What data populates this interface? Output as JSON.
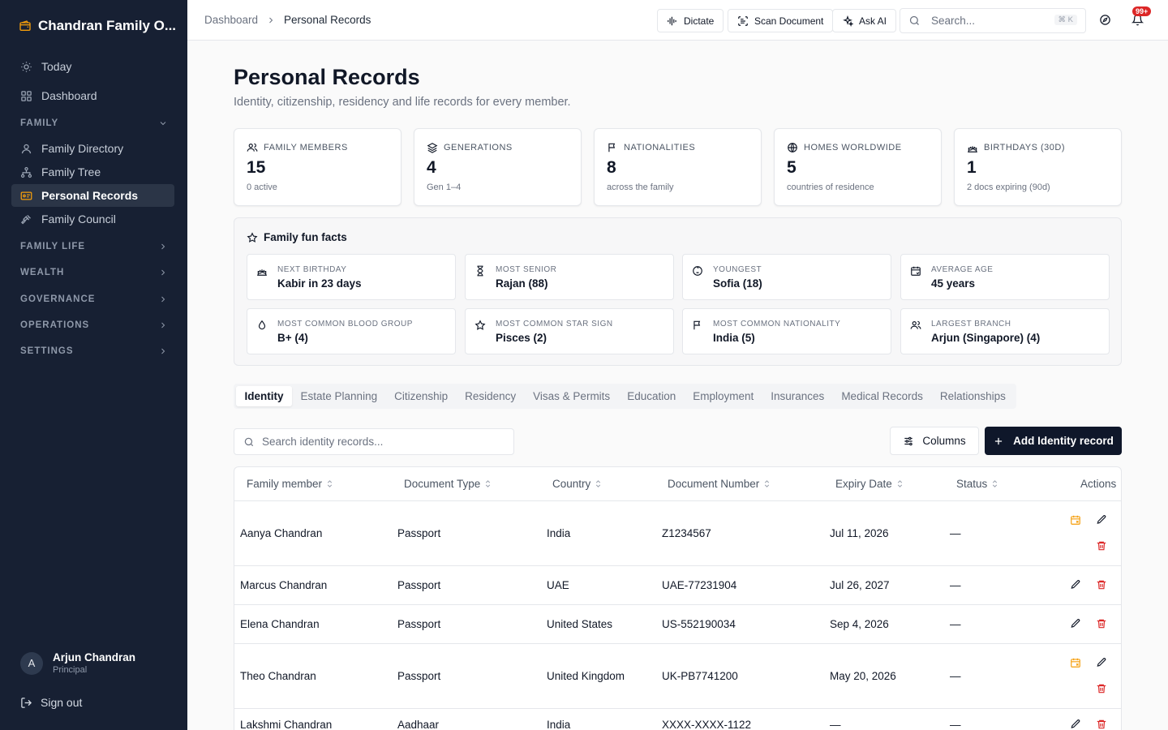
{
  "app": {
    "title": "Chandran Family O..."
  },
  "sidebar": {
    "today": "Today",
    "dashboard": "Dashboard",
    "family_section": "FAMILY",
    "family_items": [
      "Family Directory",
      "Family Tree",
      "Personal Records",
      "Family Council"
    ],
    "sections": [
      "FAMILY LIFE",
      "WEALTH",
      "GOVERNANCE",
      "OPERATIONS",
      "SETTINGS"
    ],
    "user": {
      "initial": "A",
      "name": "Arjun Chandran",
      "role": "Principal"
    },
    "sign_out": "Sign out"
  },
  "topbar": {
    "breadcrumb": [
      "Dashboard",
      "Personal Records"
    ],
    "dictate": "Dictate",
    "scan": "Scan Document",
    "ask_ai": "Ask AI",
    "search_placeholder": "Search...",
    "shortcut": "⌘ K",
    "notifications": "99+"
  },
  "page": {
    "title": "Personal Records",
    "subtitle": "Identity, citizenship, residency and life records for every member."
  },
  "stats": [
    {
      "icon": "users-icon",
      "label": "FAMILY MEMBERS",
      "value": "15",
      "sub": "0 active"
    },
    {
      "icon": "layers-icon",
      "label": "GENERATIONS",
      "value": "4",
      "sub": "Gen 1–4"
    },
    {
      "icon": "flag-icon",
      "label": "NATIONALITIES",
      "value": "8",
      "sub": "across the family"
    },
    {
      "icon": "globe-icon",
      "label": "HOMES WORLDWIDE",
      "value": "5",
      "sub": "countries of residence"
    },
    {
      "icon": "cake-icon",
      "label": "BIRTHDAYS (30D)",
      "value": "1",
      "sub": "2 docs expiring (90d)"
    }
  ],
  "fun_facts": {
    "title": "Family fun facts",
    "items": [
      {
        "icon": "cake-icon",
        "label": "NEXT BIRTHDAY",
        "value": "Kabir in 23 days"
      },
      {
        "icon": "hourglass-icon",
        "label": "MOST SENIOR",
        "value": "Rajan (88)"
      },
      {
        "icon": "baby-icon",
        "label": "YOUNGEST",
        "value": "Sofia (18)"
      },
      {
        "icon": "calendar-icon",
        "label": "AVERAGE AGE",
        "value": "45 years"
      },
      {
        "icon": "droplet-icon",
        "label": "MOST COMMON BLOOD GROUP",
        "value": "B+ (4)"
      },
      {
        "icon": "star-icon",
        "label": "MOST COMMON STAR SIGN",
        "value": "Pisces (2)"
      },
      {
        "icon": "flag-icon",
        "label": "MOST COMMON NATIONALITY",
        "value": "India (5)"
      },
      {
        "icon": "users-icon",
        "label": "LARGEST BRANCH",
        "value": "Arjun (Singapore) (4)"
      }
    ]
  },
  "tabs": [
    "Identity",
    "Estate Planning",
    "Citizenship",
    "Residency",
    "Visas & Permits",
    "Education",
    "Employment",
    "Insurances",
    "Medical Records",
    "Relationships"
  ],
  "toolbar": {
    "search_placeholder": "Search identity records...",
    "columns": "Columns",
    "add": "Add Identity record"
  },
  "table": {
    "headers": [
      "Family member",
      "Document Type",
      "Country",
      "Document Number",
      "Expiry Date",
      "Status",
      "Actions"
    ],
    "rows": [
      {
        "member": "Aanya Chandran",
        "type": "Passport",
        "country": "India",
        "number": "Z1234567",
        "expiry": "Jul 11, 2026",
        "status": "—",
        "reminder": true
      },
      {
        "member": "Marcus Chandran",
        "type": "Passport",
        "country": "UAE",
        "number": "UAE-77231904",
        "expiry": "Jul 26, 2027",
        "status": "—",
        "reminder": false
      },
      {
        "member": "Elena Chandran",
        "type": "Passport",
        "country": "United States",
        "number": "US-552190034",
        "expiry": "Sep 4, 2026",
        "status": "—",
        "reminder": false
      },
      {
        "member": "Theo Chandran",
        "type": "Passport",
        "country": "United Kingdom",
        "number": "UK-PB7741200",
        "expiry": "May 20, 2026",
        "status": "—",
        "reminder": true
      },
      {
        "member": "Lakshmi Chandran",
        "type": "Aadhaar",
        "country": "India",
        "number": "XXXX-XXXX-1122",
        "expiry": "—",
        "status": "—",
        "reminder": false
      }
    ]
  },
  "colors": {
    "sidebar": "#172033",
    "accent": "#0f172a",
    "danger": "#dc2626",
    "warning": "#f59e0b"
  }
}
